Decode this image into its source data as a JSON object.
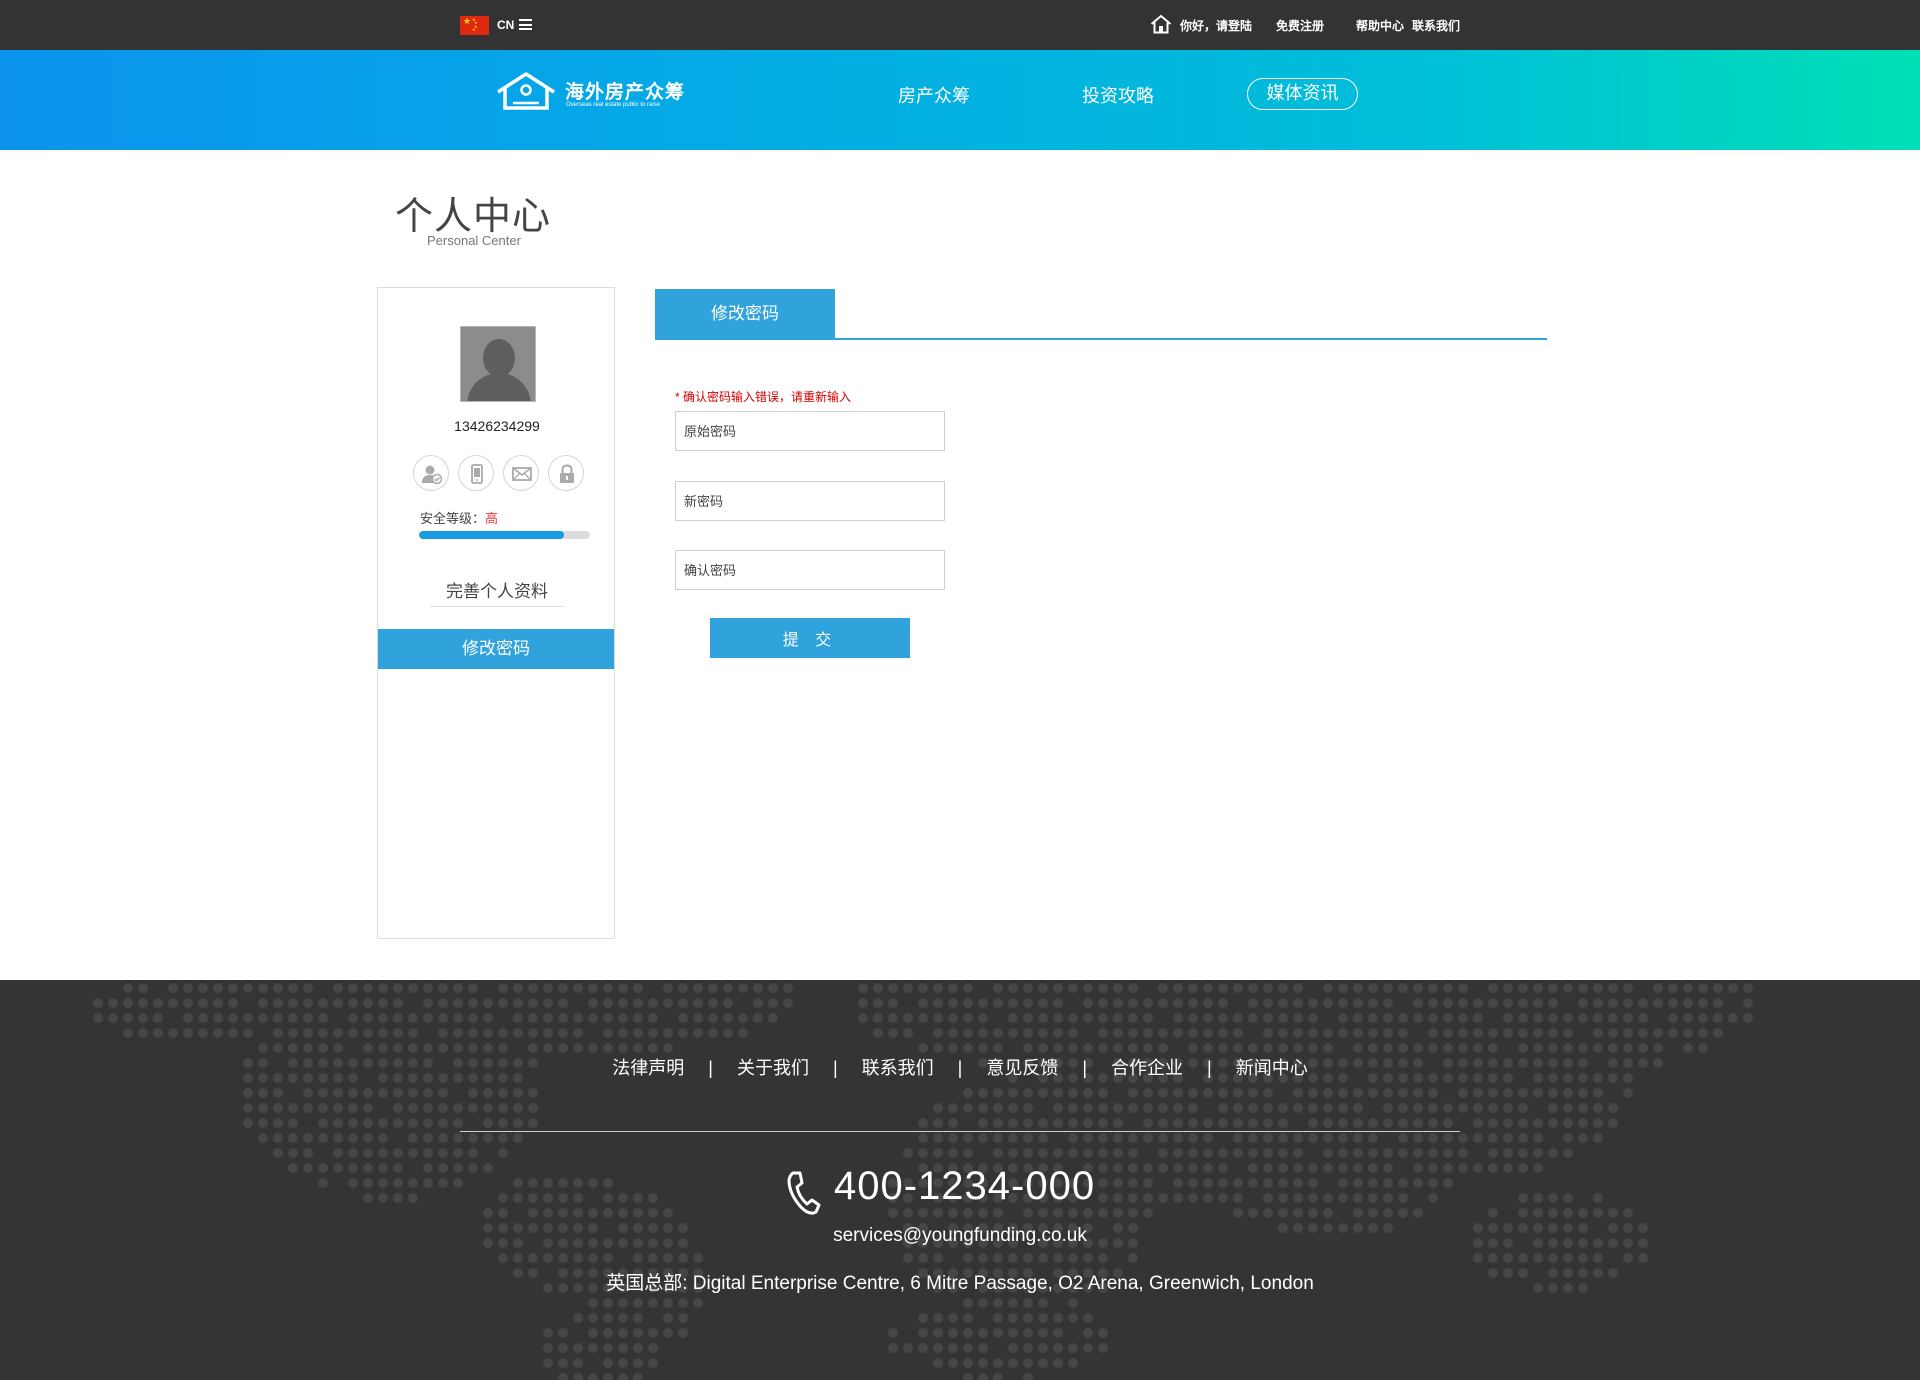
{
  "topbar": {
    "lang": "CN",
    "greeting": "你好，请登陆",
    "register": "免费注册",
    "help": "帮助中心",
    "contact": "联系我们"
  },
  "header": {
    "logo_title": "海外房产众筹",
    "logo_subtitle": "Overseas real estate public to raise",
    "nav": [
      "房产众筹",
      "投资攻略",
      "媒体资讯"
    ],
    "active_nav": "媒体资讯"
  },
  "page": {
    "title": "个人中心",
    "subtitle": "Personal Center"
  },
  "sidebar": {
    "phone": "13426234299",
    "icons": [
      "user-verified-icon",
      "mobile-icon",
      "mail-icon",
      "lock-icon"
    ],
    "security_label": "安全等级：",
    "security_level": "高",
    "security_progress": 0.85,
    "links": [
      "完善个人资料",
      "修改密码"
    ],
    "active_link": "修改密码"
  },
  "form": {
    "tab": "修改密码",
    "error": "* 确认密码输入错误，请重新输入",
    "old_password_placeholder": "原始密码",
    "new_password_placeholder": "新密码",
    "confirm_password_placeholder": "确认密码",
    "submit_label": "提 交"
  },
  "footer": {
    "links": [
      "法律声明",
      "关于我们",
      "联系我们",
      "意见反馈",
      "合作企业",
      "新闻中心"
    ],
    "separator": "|",
    "hotline": "400-1234-000",
    "email": "services@youngfunding.co.uk",
    "address": "英国总部: Digital Enterprise Centre, 6 Mitre Passage, O2 Arena, Greenwich, London"
  },
  "colors": {
    "accent": "#30a2dc",
    "error": "#d60000",
    "footer_bg": "#343434",
    "topbar_bg": "#333333"
  }
}
